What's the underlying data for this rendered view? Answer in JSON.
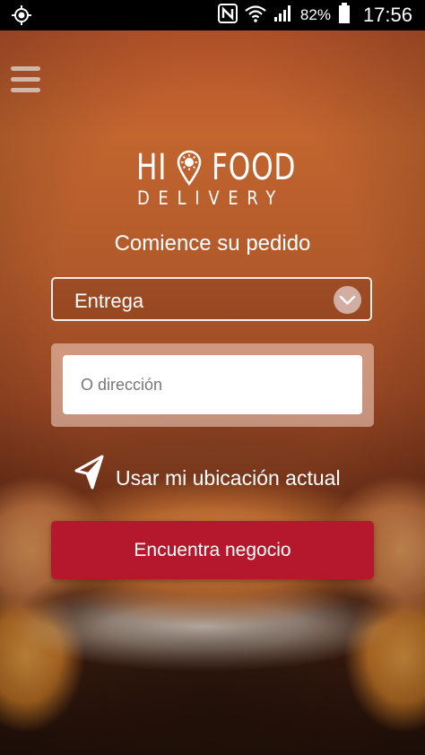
{
  "status_bar": {
    "battery_percent": "82%",
    "time": "17:56",
    "icons": [
      "gps-icon",
      "nfc-icon",
      "wifi-icon",
      "signal-icon",
      "battery-icon"
    ]
  },
  "app": {
    "menu_icon": "hamburger-menu-icon",
    "logo": {
      "line1_left": "HI",
      "line1_right": "FOOD",
      "line2": "DELIVERY"
    },
    "subtitle": "Comience su pedido",
    "order_type": {
      "selected": "Entrega",
      "icon": "chevron-down-icon"
    },
    "address": {
      "value": "",
      "placeholder": "O dirección"
    },
    "use_location": {
      "label": "Usar mi ubicación actual",
      "icon": "navigation-arrow-icon"
    },
    "find_button": "Encuentra negocio"
  },
  "colors": {
    "primary_button": "#b5182d",
    "status_bar": "#000000",
    "text": "#ffffff"
  }
}
